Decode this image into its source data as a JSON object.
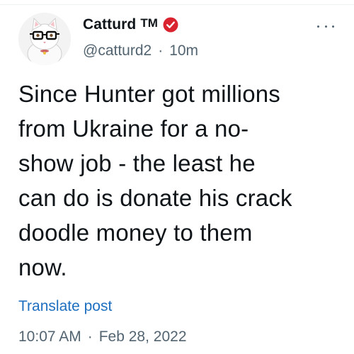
{
  "author": {
    "display_name": "Catturd",
    "trademark": "TM",
    "handle": "@catturd2",
    "separator": "·",
    "time_ago": "10m",
    "badge_color": "#d9242f"
  },
  "tweet": {
    "lines": [
      "Since Hunter got millions",
      "from Ukraine for a no-",
      "show job - the least he",
      "can do is donate his crack",
      "doodle money to them",
      "now."
    ],
    "translate_label": "Translate post"
  },
  "meta": {
    "time": "10:07 AM",
    "separator": "·",
    "date": "Feb 28, 2022"
  },
  "icons": {
    "avatar": "cat-with-glasses-avatar",
    "badge": "verified-badge-icon",
    "more": "more-options-icon"
  },
  "colors": {
    "link": "#1d6fbf",
    "secondary_text": "#536471",
    "primary_text": "#0f1419"
  }
}
